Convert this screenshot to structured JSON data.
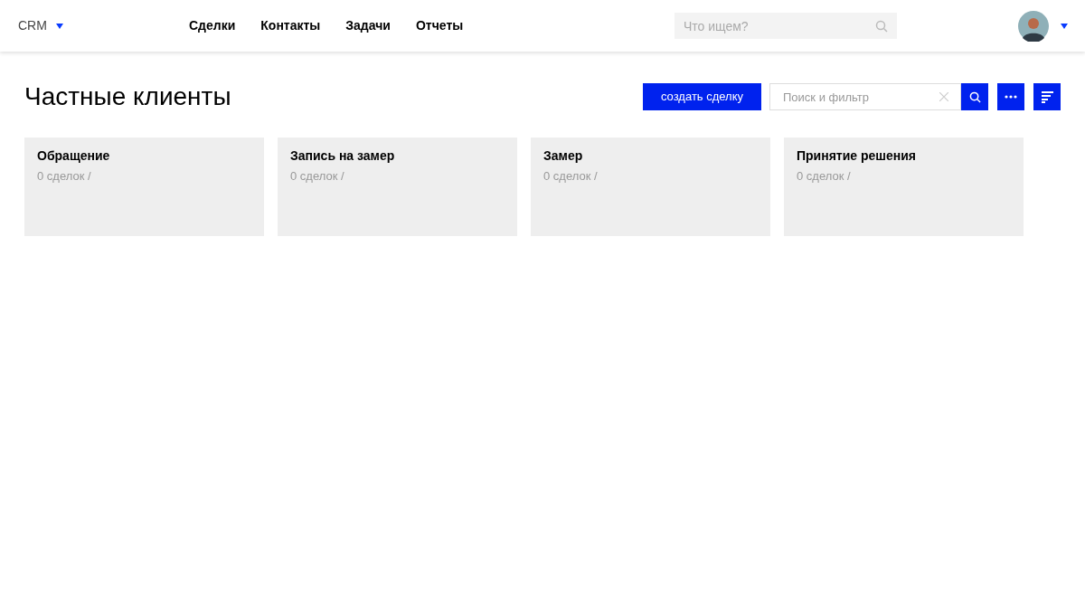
{
  "header": {
    "app_menu": "CRM",
    "nav": [
      "Сделки",
      "Контакты",
      "Задачи",
      "Отчеты"
    ],
    "search": {
      "placeholder": "Что ищем?"
    }
  },
  "page": {
    "title": "Частные клиенты",
    "create_button": "создать сделку",
    "filter": {
      "placeholder": "Поиск и фильтр"
    }
  },
  "stages": [
    {
      "name": "Обращение",
      "count": "0 сделок /"
    },
    {
      "name": "Запись на замер",
      "count": "0 сделок /"
    },
    {
      "name": "Замер",
      "count": "0 сделок /"
    },
    {
      "name": "Принятие решения",
      "count": "0 сделок /"
    }
  ]
}
